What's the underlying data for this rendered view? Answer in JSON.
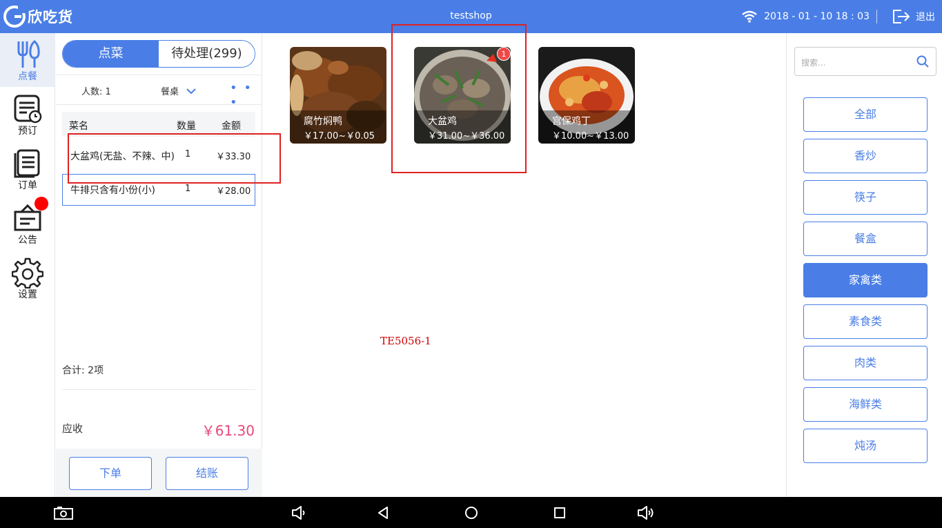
{
  "app": {
    "logo_text": "欣吃货",
    "shop_name": "testshop",
    "datetime": "2018 - 01 - 10  18 : 03",
    "exit_label": "退出"
  },
  "sidenav": [
    {
      "label": "点餐",
      "icon": "fork-knife-icon",
      "active": true
    },
    {
      "label": "预订",
      "icon": "reservation-icon",
      "active": false
    },
    {
      "label": "订单",
      "icon": "order-list-icon",
      "active": false
    },
    {
      "label": "公告",
      "icon": "announcement-icon",
      "active": false,
      "badge": true
    },
    {
      "label": "设置",
      "icon": "gear-icon",
      "active": false
    }
  ],
  "order": {
    "tabs": {
      "order_tab": "点菜",
      "pending_tab": "待处理(299)"
    },
    "people": "人数: 1",
    "table_select": "餐桌",
    "more": "• • •",
    "columns": {
      "name": "菜名",
      "qty": "数量",
      "amount": "金额"
    },
    "items": [
      {
        "name": "大盆鸡(无盐、不辣、中)",
        "qty": "1",
        "amount": "￥33.30"
      },
      {
        "name": "牛排只含有小份(小)",
        "qty": "1",
        "amount": "￥28.00"
      }
    ],
    "total_items": "合计:  2项",
    "due_label": "应收",
    "due_amount": "￥61.30",
    "submit_button": "下单",
    "checkout_button": "结账"
  },
  "dishes": [
    {
      "name": "腐竹焖鸭",
      "price": "￥17.00~￥0.05"
    },
    {
      "name": "大盆鸡",
      "price": "￥31.00~￥36.00",
      "count": "1"
    },
    {
      "name": "宫保鸡丁",
      "price": "￥10.00~￥13.00"
    }
  ],
  "watermark": "TE5056-1",
  "search": {
    "placeholder": "搜索..."
  },
  "categories": [
    "全部",
    "香炒",
    "筷子",
    "餐盒",
    "家禽类",
    "素食类",
    "肉类",
    "海鲜类",
    "炖汤"
  ],
  "active_category": "家禽类",
  "colors": {
    "primary": "#4a7ee6",
    "due": "#e8497a",
    "badge": "#f04848",
    "highlight_box": "#e02020"
  }
}
